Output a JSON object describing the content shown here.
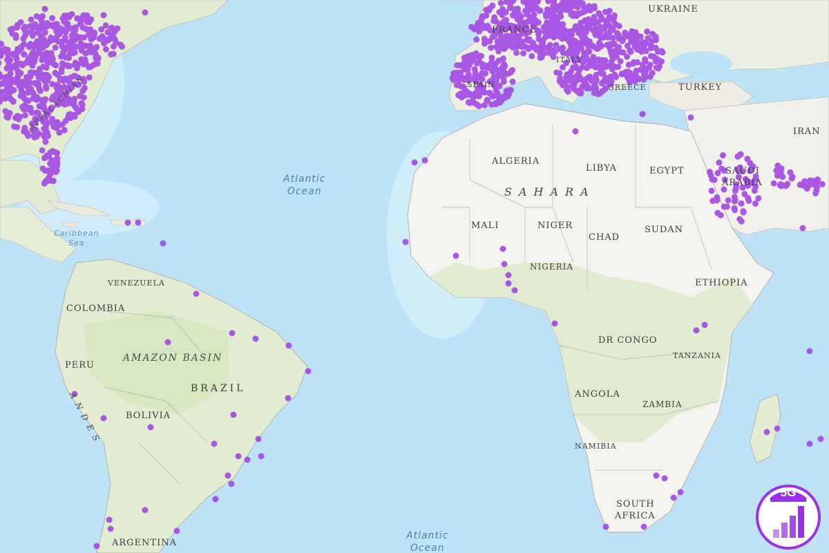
{
  "map": {
    "countries": [
      {
        "name": "UKRAINE"
      },
      {
        "name": "FRANCE"
      },
      {
        "name": "ITALY"
      },
      {
        "name": "SPAIN"
      },
      {
        "name": "GREECE"
      },
      {
        "name": "TURKEY"
      },
      {
        "name": "IRAN"
      },
      {
        "name": "ALGERIA"
      },
      {
        "name": "LIBYA"
      },
      {
        "name": "EGYPT"
      },
      {
        "name": "SAUDI"
      },
      {
        "name": "ARABIA"
      },
      {
        "name": "MALI"
      },
      {
        "name": "NIGER"
      },
      {
        "name": "CHAD"
      },
      {
        "name": "SUDAN"
      },
      {
        "name": "NIGERIA"
      },
      {
        "name": "ETHIOPIA"
      },
      {
        "name": "DR CONGO"
      },
      {
        "name": "TANZANIA"
      },
      {
        "name": "ANGOLA"
      },
      {
        "name": "ZAMBIA"
      },
      {
        "name": "NAMIBIA"
      },
      {
        "name": "SOUTH"
      },
      {
        "name": "AFRICA"
      },
      {
        "name": "VENEZUELA"
      },
      {
        "name": "COLOMBIA"
      },
      {
        "name": "PERU"
      },
      {
        "name": "BRAZIL"
      },
      {
        "name": "BOLIVIA"
      },
      {
        "name": "ARGENTINA"
      }
    ],
    "regions": {
      "sahara": "SAHARA",
      "amazon": "AMAZON BASIN",
      "andes": "ANDES",
      "appalachian": "APPALACHIAN"
    },
    "water": {
      "atlantic_north": [
        "Atlantic",
        "Ocean"
      ],
      "atlantic_south": [
        "Atlantic",
        "Ocean"
      ],
      "caribbean": [
        "Caribbean",
        "Sea"
      ]
    },
    "colors": {
      "ocean": "#bfe3f6",
      "land": "#f4f3ef",
      "vegetation": "#dce8c6",
      "border": "#a9a9a9",
      "coverage": "#a347e6"
    }
  },
  "badge": {
    "label": "5G",
    "icon": "signal-bars-icon",
    "color": "#9b30e8"
  }
}
